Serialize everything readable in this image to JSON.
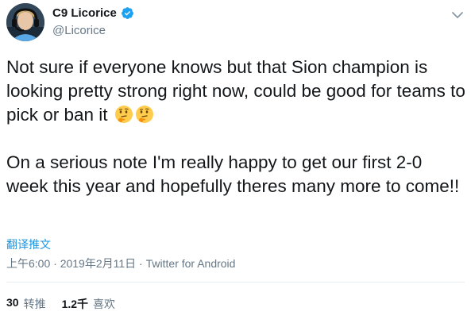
{
  "author": {
    "display_name": "C9 Licorice",
    "handle": "@Licorice",
    "verified": true
  },
  "tweet": {
    "paragraph1": "Not sure if everyone knows but that Sion champion is looking pretty strong right now, could be good for teams to pick or ban it",
    "paragraph1_emojis": [
      "thinking-face-icon",
      "thinking-face-icon"
    ],
    "paragraph2": "On a serious note I'm really happy to get our first 2-0 week this year and hopefully theres many more to come!!"
  },
  "translate_link": "翻译推文",
  "meta": {
    "time": "上午6:00",
    "separator1": " · ",
    "date": "2019年2月11日",
    "separator2": " · ",
    "source": "Twitter for Android"
  },
  "stats": {
    "retweets_count": "30",
    "retweets_label": "转推",
    "likes_count": "1.2千",
    "likes_label": "喜欢"
  },
  "colors": {
    "accent": "#1b95e0",
    "verified": "#1da1f2",
    "secondary_text": "#657786"
  }
}
